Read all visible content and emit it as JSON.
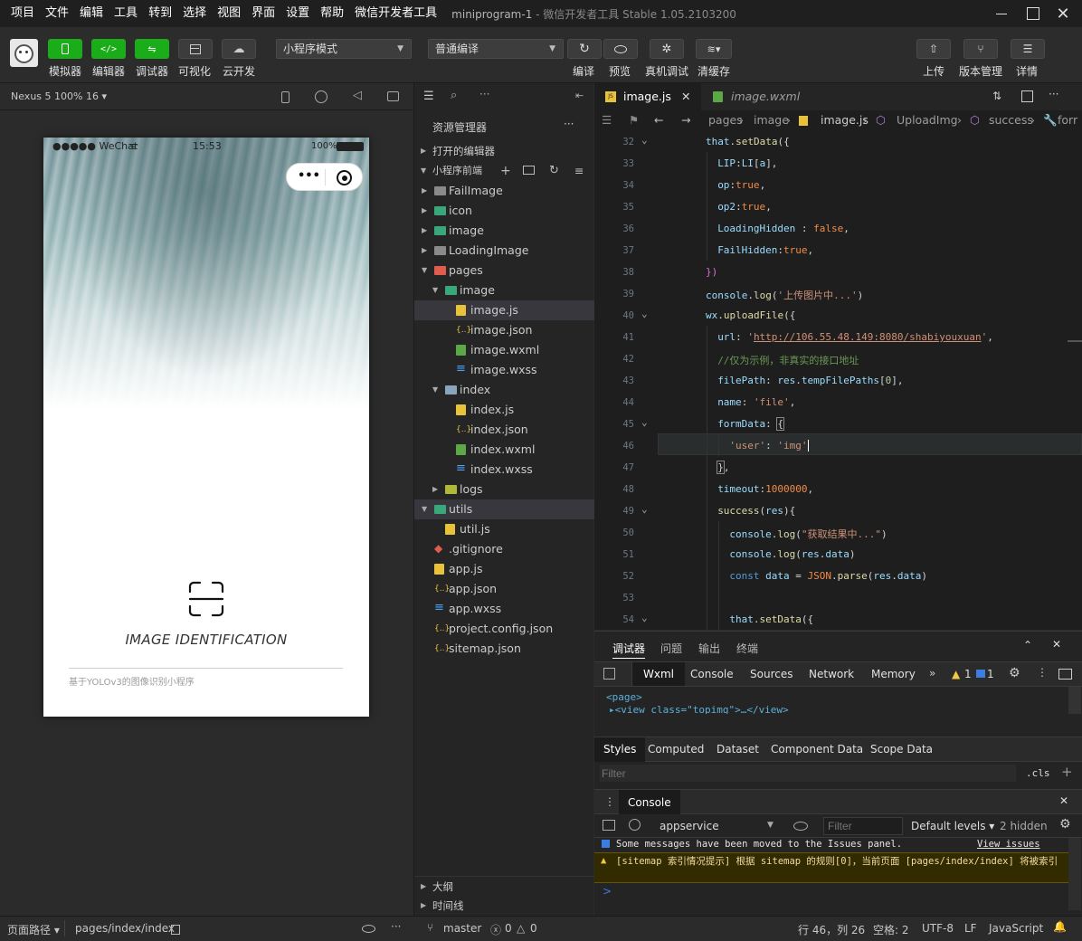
{
  "window": {
    "menu": [
      "项目",
      "文件",
      "编辑",
      "工具",
      "转到",
      "选择",
      "视图",
      "界面",
      "设置",
      "帮助",
      "微信开发者工具"
    ],
    "project": "miniprogram-1",
    "app_name": "- 微信开发者工具 Stable 1.05.2103200"
  },
  "toolbar": {
    "simulator": "模拟器",
    "editor": "编辑器",
    "debugger": "调试器",
    "visual": "可视化",
    "cloud": "云开发",
    "mode": "小程序模式",
    "compile": "普通编译",
    "compile_btn": "编译",
    "preview": "预览",
    "remote_debug": "真机调试",
    "clear_cache": "清缓存",
    "upload": "上传",
    "version": "版本管理",
    "details": "详情"
  },
  "simulator": {
    "device": "Nexus 5 100% 16",
    "carrier": "●●●●● WeChat",
    "time": "15:53",
    "battery": "100%",
    "app_title": "IMAGE IDENTIFICATION",
    "app_subtitle": "基于YOLOv3的图像识别小程序"
  },
  "explorer": {
    "title": "资源管理器",
    "open_editors": "打开的编辑器",
    "project_section": "小程序前端",
    "items": [
      {
        "label": "FailImage"
      },
      {
        "label": "icon"
      },
      {
        "label": "image"
      },
      {
        "label": "LoadingImage"
      },
      {
        "label": "pages"
      },
      {
        "label": "image"
      },
      {
        "label": "image.js"
      },
      {
        "label": "image.json"
      },
      {
        "label": "image.wxml"
      },
      {
        "label": "image.wxss"
      },
      {
        "label": "index"
      },
      {
        "label": "index.js"
      },
      {
        "label": "index.json"
      },
      {
        "label": "index.wxml"
      },
      {
        "label": "index.wxss"
      },
      {
        "label": "logs"
      },
      {
        "label": "utils"
      },
      {
        "label": "util.js"
      },
      {
        "label": ".gitignore"
      },
      {
        "label": "app.js"
      },
      {
        "label": "app.json"
      },
      {
        "label": "app.wxss"
      },
      {
        "label": "project.config.json"
      },
      {
        "label": "sitemap.json"
      }
    ],
    "outline": "大纲",
    "timeline": "时间线"
  },
  "editor": {
    "tabs": [
      "image.js",
      "image.wxml"
    ],
    "breadcrumb": [
      "pages",
      "image",
      "image.js",
      "UploadImg",
      "success",
      "forr"
    ],
    "line_numbers": [
      "32",
      "33",
      "34",
      "35",
      "36",
      "37",
      "38",
      "39",
      "40",
      "41",
      "42",
      "43",
      "44",
      "45",
      "46",
      "47",
      "48",
      "49",
      "50",
      "51",
      "52",
      "53",
      "54"
    ]
  },
  "devtools": {
    "top_tabs": [
      "调试器",
      "问题",
      "输出",
      "终端"
    ],
    "panel_tabs": [
      "Wxml",
      "Console",
      "Sources",
      "Network",
      "Memory"
    ],
    "warn_count": "1",
    "info_count": "1",
    "wxml_line1": "<page>",
    "wxml_line2": "▸<view class=\"topimg\">…</view>",
    "style_tabs": [
      "Styles",
      "Computed",
      "Dataset",
      "Component Data",
      "Scope Data"
    ],
    "filter_placeholder": "Filter",
    "cls": ".cls",
    "console_title": "Console",
    "context": "appservice",
    "console_filter": "Filter",
    "levels": "Default levels",
    "hidden": "2 hidden",
    "msg_info": "Some messages have been moved to the Issues panel.",
    "view_issues": "View issues",
    "msg_warn": "[sitemap 索引情况提示] 根据 sitemap 的规则[0]，当前页面 [pages/index/index] 将被索引",
    "prompt": ">"
  },
  "statusbar": {
    "page_path_label": "页面路径",
    "page_path": "pages/index/index",
    "branch": "master",
    "errors": "0",
    "warnings": "0",
    "position": "行 46，列 26",
    "indent": "空格: 2",
    "encoding": "UTF-8",
    "eol": "LF",
    "language": "JavaScript"
  },
  "colors": {
    "accent_green": "#1aad19",
    "editor_bg": "#1e1e1e",
    "sidebar_bg": "#252526"
  }
}
